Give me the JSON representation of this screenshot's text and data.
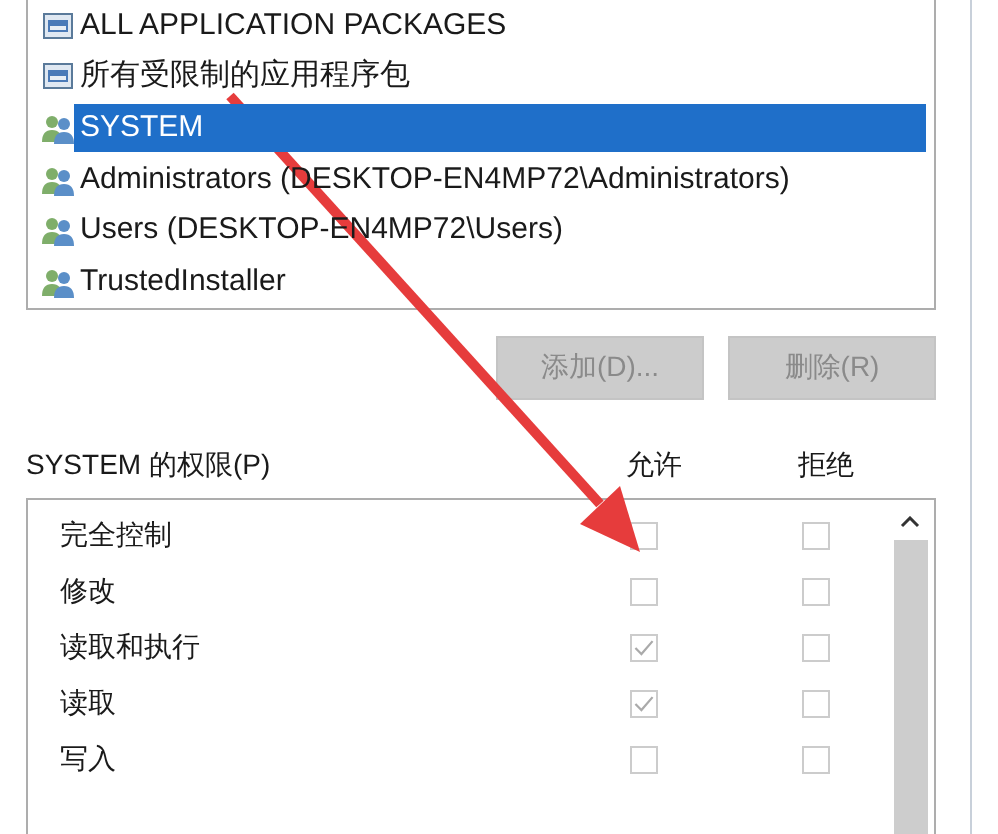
{
  "principals": [
    {
      "name": "ALL APPLICATION PACKAGES",
      "kind": "package",
      "selected": false
    },
    {
      "name": "所有受限制的应用程序包",
      "kind": "package",
      "selected": false
    },
    {
      "name": "SYSTEM",
      "kind": "group",
      "selected": true
    },
    {
      "name": "Administrators (DESKTOP-EN4MP72\\Administrators)",
      "kind": "group",
      "selected": false
    },
    {
      "name": "Users (DESKTOP-EN4MP72\\Users)",
      "kind": "group",
      "selected": false
    },
    {
      "name": "TrustedInstaller",
      "kind": "group",
      "selected": false
    }
  ],
  "buttons": [
    {
      "label": "添加(D)...",
      "disabled": true
    },
    {
      "label": "删除(R)",
      "disabled": true
    }
  ],
  "permissions": {
    "title": "SYSTEM 的权限(P)",
    "allow_header": "允许",
    "deny_header": "拒绝",
    "disabled": true,
    "rows": [
      {
        "label": "完全控制",
        "allow": false,
        "deny": false
      },
      {
        "label": "修改",
        "allow": false,
        "deny": false
      },
      {
        "label": "读取和执行",
        "allow": true,
        "deny": false
      },
      {
        "label": "读取",
        "allow": true,
        "deny": false
      },
      {
        "label": "写入",
        "allow": false,
        "deny": false
      }
    ]
  }
}
